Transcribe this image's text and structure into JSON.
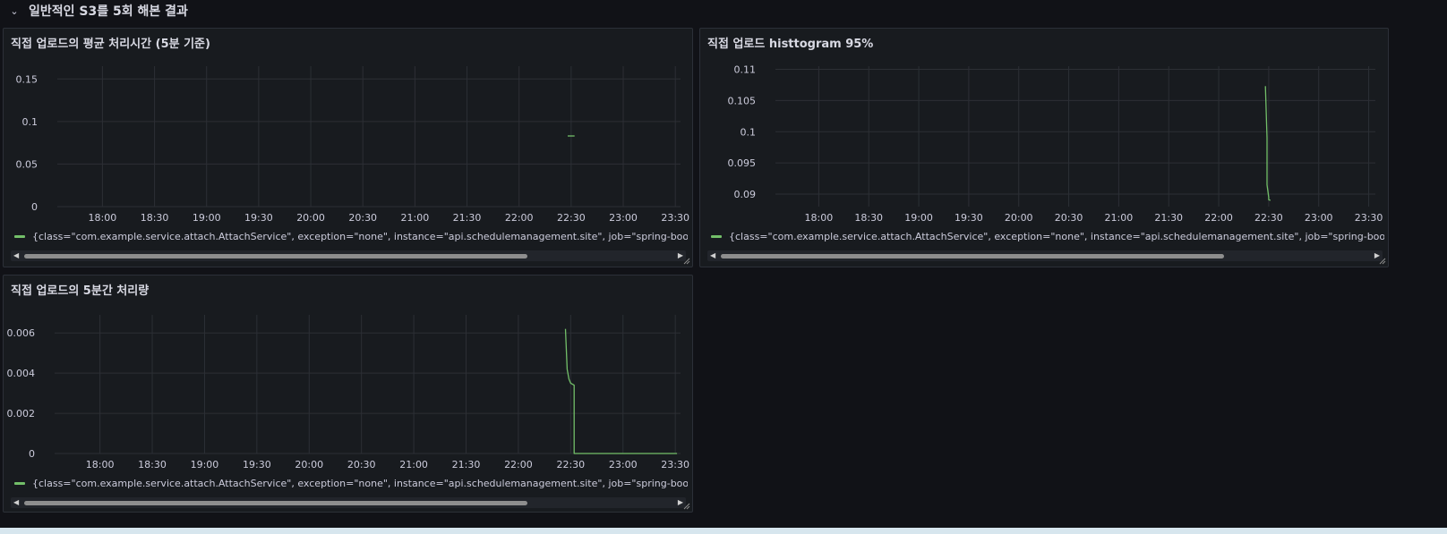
{
  "row": {
    "title": "일반적인 S3를 5회 해본 결과"
  },
  "panels": [
    {
      "title": "직접 업로드의 평균 처리시간 (5분 기준)",
      "legend": "{class=\"com.example.service.attach.AttachService\", exception=\"none\", instance=\"api.schedulemanagement.site\", job=\"spring-boot\", meth"
    },
    {
      "title": "직접 업로드 histtogram 95%",
      "legend": "{class=\"com.example.service.attach.AttachService\", exception=\"none\", instance=\"api.schedulemanagement.site\", job=\"spring-boot\", meth"
    },
    {
      "title": "직접 업로드의 5분간 처리량",
      "legend": "{class=\"com.example.service.attach.AttachService\", exception=\"none\", instance=\"api.schedulemanagement.site\", job=\"spring-boot\", meth"
    }
  ],
  "chart_data": [
    {
      "type": "line",
      "title": "직접 업로드의 평균 처리시간 (5분 기준)",
      "x_ticks": [
        "18:00",
        "18:30",
        "19:00",
        "19:30",
        "20:00",
        "20:30",
        "21:00",
        "21:30",
        "22:00",
        "22:30",
        "23:00",
        "23:30"
      ],
      "y_ticks": [
        "0",
        "0.05",
        "0.1",
        "0.15"
      ],
      "xlim": [
        "17:34",
        "23:33"
      ],
      "ylim": [
        0,
        0.165
      ],
      "grid": true,
      "legend_position": "bottom",
      "color": "#73bf69",
      "series": [
        {
          "x": [
            "22:28",
            "22:32"
          ],
          "y": [
            0.083,
            0.083
          ]
        }
      ]
    },
    {
      "type": "line",
      "title": "직접 업로드 histtogram 95%",
      "x_ticks": [
        "18:00",
        "18:30",
        "19:00",
        "19:30",
        "20:00",
        "20:30",
        "21:00",
        "21:30",
        "22:00",
        "22:30",
        "23:00",
        "23:30"
      ],
      "y_ticks": [
        "0.09",
        "0.095",
        "0.1",
        "0.105",
        "0.11"
      ],
      "xlim": [
        "17:34",
        "23:34"
      ],
      "ylim": [
        0.088,
        0.1105
      ],
      "grid": true,
      "legend_position": "bottom",
      "color": "#73bf69",
      "series": [
        {
          "x": [
            "22:28",
            "22:29",
            "22:29",
            "22:30",
            "22:30",
            "22:31"
          ],
          "y": [
            0.1073,
            0.099,
            0.0915,
            0.0895,
            0.0891,
            0.089
          ]
        }
      ]
    },
    {
      "type": "line",
      "title": "직접 업로드의 5분간 처리량",
      "x_ticks": [
        "18:00",
        "18:30",
        "19:00",
        "19:30",
        "20:00",
        "20:30",
        "21:00",
        "21:30",
        "22:00",
        "22:30",
        "23:00",
        "23:30"
      ],
      "y_ticks": [
        "0",
        "0.002",
        "0.004",
        "0.006"
      ],
      "xlim": [
        "17:34",
        "23:33"
      ],
      "ylim": [
        0,
        0.0069
      ],
      "grid": true,
      "legend_position": "bottom",
      "color": "#73bf69",
      "series": [
        {
          "x": [
            "22:27",
            "22:28",
            "22:29",
            "22:30",
            "22:32",
            "22:32",
            "22:33",
            "23:31"
          ],
          "y": [
            0.0062,
            0.0042,
            0.0037,
            0.0035,
            0.0034,
            0.0,
            0.0,
            0.0
          ]
        }
      ]
    }
  ]
}
